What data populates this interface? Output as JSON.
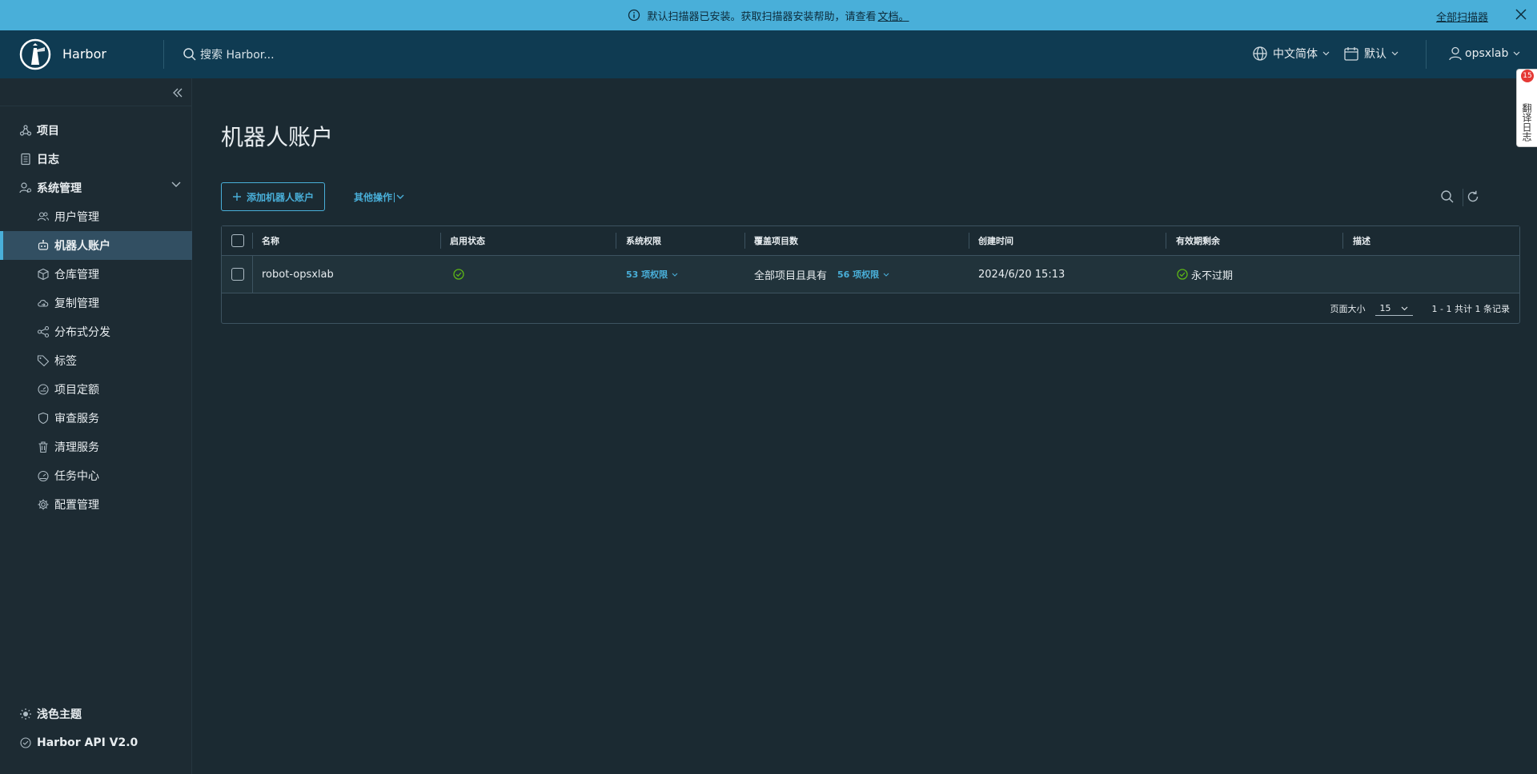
{
  "banner": {
    "message": "默认扫描器已安装。获取扫描器安装帮助，请查看",
    "link_text": "文档。",
    "right_link": "全部扫描器"
  },
  "header": {
    "brand": "Harbor",
    "search_placeholder": "搜索 Harbor...",
    "language": "中文简体",
    "date_format": "默认",
    "user": "opsxlab"
  },
  "sidebar": {
    "items": [
      {
        "label": "项目",
        "icon": "projects-icon"
      },
      {
        "label": "日志",
        "icon": "log-icon"
      },
      {
        "label": "系统管理",
        "icon": "admin-icon"
      }
    ],
    "subitems": [
      {
        "label": "用户管理",
        "icon": "users-icon"
      },
      {
        "label": "机器人账户",
        "icon": "robot-icon"
      },
      {
        "label": "仓库管理",
        "icon": "registry-icon"
      },
      {
        "label": "复制管理",
        "icon": "replication-icon"
      },
      {
        "label": "分布式分发",
        "icon": "distribution-icon"
      },
      {
        "label": "标签",
        "icon": "tag-icon"
      },
      {
        "label": "项目定额",
        "icon": "quota-icon"
      },
      {
        "label": "审查服务",
        "icon": "shield-icon"
      },
      {
        "label": "清理服务",
        "icon": "trash-icon"
      },
      {
        "label": "任务中心",
        "icon": "dashboard-icon"
      },
      {
        "label": "配置管理",
        "icon": "gear-icon"
      }
    ],
    "bottom": [
      {
        "label": "浅色主题",
        "icon": "sun-icon"
      },
      {
        "label": "Harbor API V2.0",
        "icon": "api-icon"
      }
    ]
  },
  "main": {
    "title": "机器人账户",
    "add_button": "添加机器人账户",
    "more_actions": "其他操作",
    "columns": [
      "名称",
      "启用状态",
      "系统权限",
      "覆盖项目数",
      "创建时间",
      "有效期剩余",
      "描述"
    ],
    "rows": [
      {
        "name": "robot-opsxlab",
        "enabled": true,
        "system_permissions": "53 项权限",
        "projects_prefix": "全部项目且具有",
        "project_permissions": "56 项权限",
        "created": "2024/6/20 15:13",
        "expires": "永不过期",
        "description": ""
      }
    ],
    "footer": {
      "page_size_label": "页面大小",
      "page_size": "15",
      "summary": "1 - 1 共计 1 条记录"
    }
  },
  "float_tab": {
    "label": "翻译日志",
    "badge": "15"
  },
  "colors": {
    "accent": "#49afd9",
    "header_bg": "#0f3b52",
    "banner_bg": "#49afd9",
    "success": "#5eb715"
  }
}
